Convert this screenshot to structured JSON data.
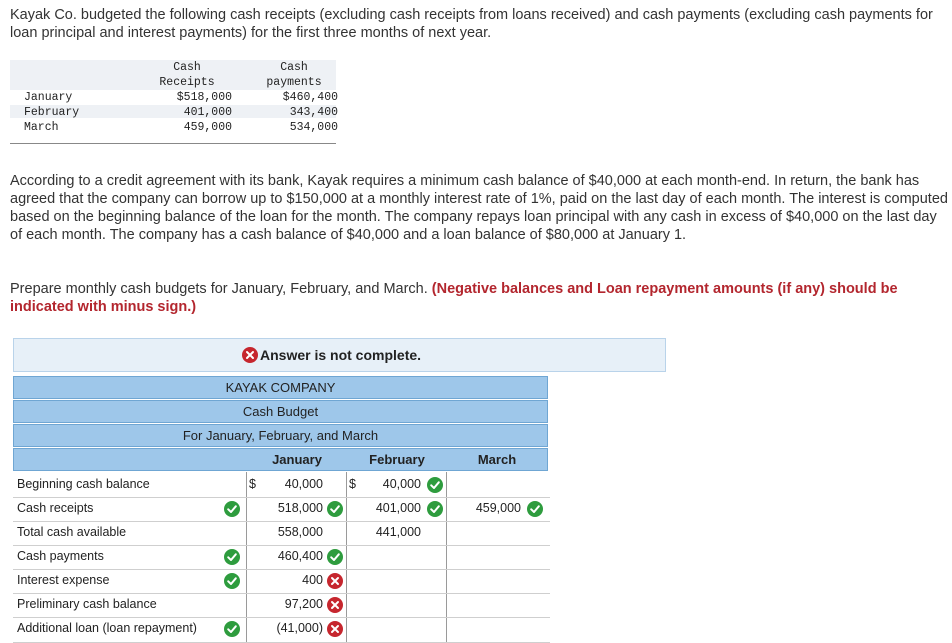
{
  "problem": {
    "intro": "Kayak Co. budgeted the following cash receipts (excluding cash receipts from loans received) and cash payments (excluding cash payments for loan principal and interest payments) for the first three months of next year.",
    "agreement": "According to a credit agreement with its bank, Kayak requires a minimum cash balance of $40,000 at each month-end. In return, the bank has agreed that the company can borrow up to $150,000 at a monthly interest rate of 1%, paid on the last day of each month. The interest is computed based on the beginning balance of the loan for the month. The company repays loan principal with any cash in excess of $40,000 on the last day of each month. The company has a cash balance of $40,000 and a loan balance of $80,000 at January 1.",
    "instruction": "Prepare monthly cash budgets for January, February, and March.",
    "instruction_note": "(Negative balances and Loan repayment amounts (if any) should be indicated with minus sign.)"
  },
  "data_table": {
    "col2_header_1": "Cash",
    "col2_header_2": "Receipts",
    "col3_header_1": "Cash",
    "col3_header_2": "payments",
    "rows": [
      {
        "month": "January",
        "receipts": "$518,000",
        "payments": "$460,400"
      },
      {
        "month": "February",
        "receipts": "401,000",
        "payments": "343,400"
      },
      {
        "month": "March",
        "receipts": "459,000",
        "payments": "534,000"
      }
    ]
  },
  "answer_status": "Answer is not complete.",
  "budget": {
    "company": "KAYAK COMPANY",
    "title": "Cash Budget",
    "period": "For January, February, and March",
    "col_jan": "January",
    "col_feb": "February",
    "col_mar": "March",
    "rows": [
      {
        "label": "Beginning cash balance",
        "jan_dollar": "$",
        "jan": "40,000",
        "feb_dollar": "$",
        "feb": "40,000"
      },
      {
        "label": "Cash receipts",
        "jan": "518,000",
        "feb": "401,000",
        "mar": "459,000"
      },
      {
        "label": "Total cash available",
        "jan": "558,000",
        "feb": "441,000"
      },
      {
        "label": "Cash payments",
        "jan": "460,400"
      },
      {
        "label": "Interest expense",
        "jan": "400"
      },
      {
        "label": "Preliminary cash balance",
        "jan": "97,200"
      },
      {
        "label": "Additional loan (loan repayment)",
        "jan": "(41,000)"
      }
    ]
  },
  "colors": {
    "header_blue": "#9ec7ea",
    "check_green": "#2e9c3e",
    "cross_red": "#c6262e",
    "note_red": "#b3262e"
  }
}
